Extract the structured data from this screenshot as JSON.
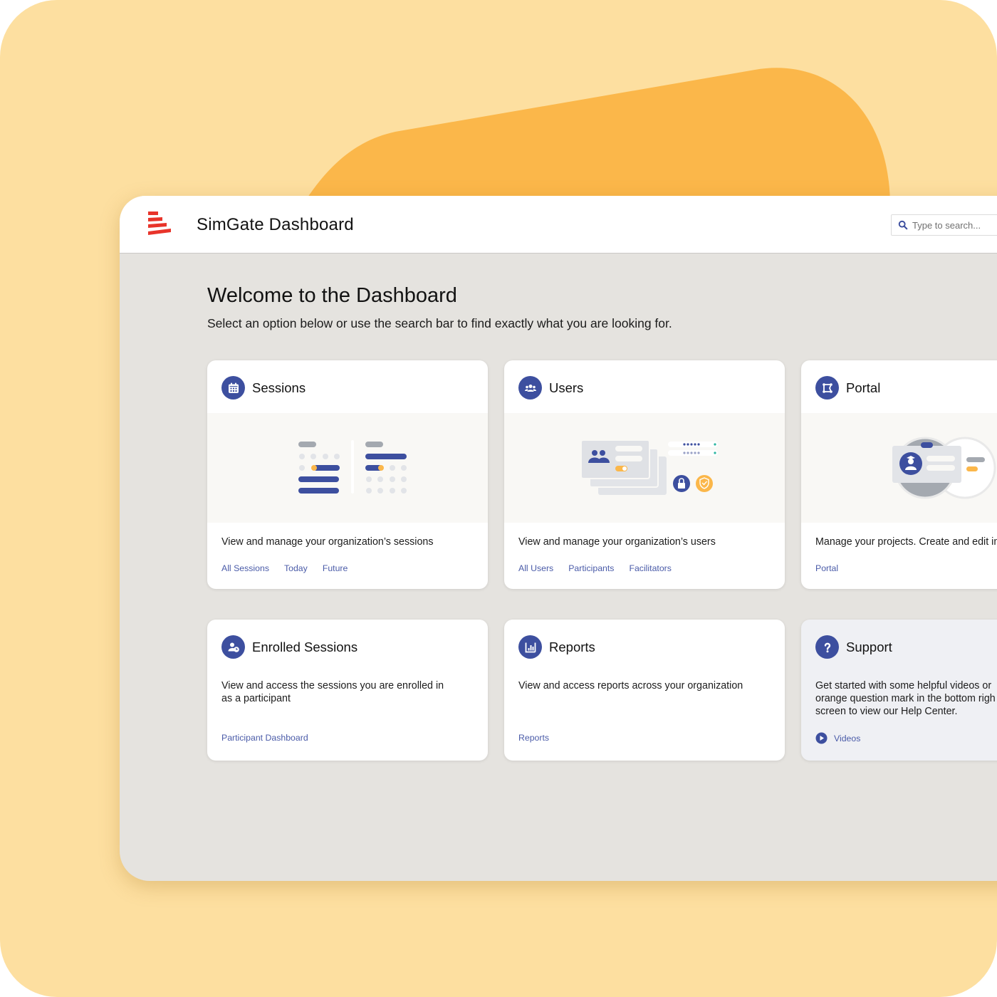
{
  "app": {
    "title": "SimGate Dashboard",
    "logo": "simgate-logo-stripes",
    "search": {
      "placeholder": "Type to search...",
      "value": "",
      "icon": "search-icon"
    }
  },
  "main": {
    "heading": "Welcome to the Dashboard",
    "subtitle": "Select an option below or use the search bar to find exactly what you are looking for."
  },
  "colors": {
    "accent": "#3d4f9f",
    "link": "#4a5ba8",
    "highlight": "#fbb74a",
    "background": "#fddfa0",
    "logo_red": "#e8342a"
  },
  "cards": [
    {
      "title": "Sessions",
      "icon": "calendar-icon",
      "illustration": "sessions-schedule-illustration",
      "description": "View and manage your organization’s sessions",
      "links": [
        {
          "label": "All Sessions"
        },
        {
          "label": "Today"
        },
        {
          "label": "Future"
        }
      ]
    },
    {
      "title": "Users",
      "icon": "users-group-icon",
      "illustration": "users-cards-illustration",
      "description": "View and manage your organization’s users",
      "links": [
        {
          "label": "All Users"
        },
        {
          "label": "Participants"
        },
        {
          "label": "Facilitators"
        }
      ]
    },
    {
      "title": "Portal",
      "icon": "portal-frame-icon",
      "illustration": "portal-id-card-illustration",
      "description": "Manage your projects. Create and edit in",
      "links": [
        {
          "label": "Portal"
        }
      ]
    },
    {
      "title": "Enrolled Sessions",
      "icon": "user-clock-icon",
      "description_lines": [
        "View and access the sessions you are enrolled in",
        "as a participant"
      ],
      "links": [
        {
          "label": "Participant Dashboard"
        }
      ]
    },
    {
      "title": "Reports",
      "icon": "bar-chart-icon",
      "description": "View and access reports across your organization",
      "links": [
        {
          "label": "Reports"
        }
      ]
    },
    {
      "title": "Support",
      "icon": "question-mark-icon",
      "description_lines": [
        "Get started with some helpful videos or",
        "orange question mark in the bottom righ",
        "screen to view our Help Center."
      ],
      "links": [
        {
          "label": "Videos",
          "icon": "play-icon"
        }
      ]
    }
  ]
}
